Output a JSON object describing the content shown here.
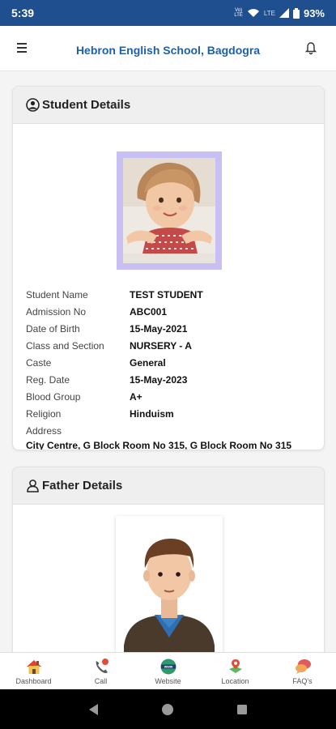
{
  "status": {
    "time": "5:39",
    "signal_small": "Vo)\nLTE",
    "lte": "LTE",
    "battery": "93%"
  },
  "app": {
    "title": "Hebron English School, Bagdogra"
  },
  "student": {
    "header": "Student Details",
    "fields": [
      {
        "label": "Student Name",
        "value": "TEST STUDENT"
      },
      {
        "label": "Admission No",
        "value": "ABC001"
      },
      {
        "label": "Date of Birth",
        "value": "15-May-2021"
      },
      {
        "label": "Class and Section",
        "value": "NURSERY - A"
      },
      {
        "label": "Caste",
        "value": "General"
      },
      {
        "label": "Reg. Date",
        "value": "15-May-2023"
      },
      {
        "label": "Blood Group",
        "value": "A+"
      },
      {
        "label": "Religion",
        "value": "Hinduism"
      }
    ],
    "address_label": "Address",
    "address_value": "City Centre, G Block Room No 315, G Block Room No 315"
  },
  "father": {
    "header": "Father Details"
  },
  "nav": [
    {
      "label": "Dashboard",
      "icon": "home-icon"
    },
    {
      "label": "Call",
      "icon": "phone-icon"
    },
    {
      "label": "Website",
      "icon": "globe-icon"
    },
    {
      "label": "Location",
      "icon": "map-pin-icon"
    },
    {
      "label": "FAQ's",
      "icon": "chat-bubble-icon"
    }
  ],
  "colors": {
    "statusbar": "#1f4f8f",
    "title": "#1f5fa8",
    "photo_frame": "#c8c0f2"
  }
}
